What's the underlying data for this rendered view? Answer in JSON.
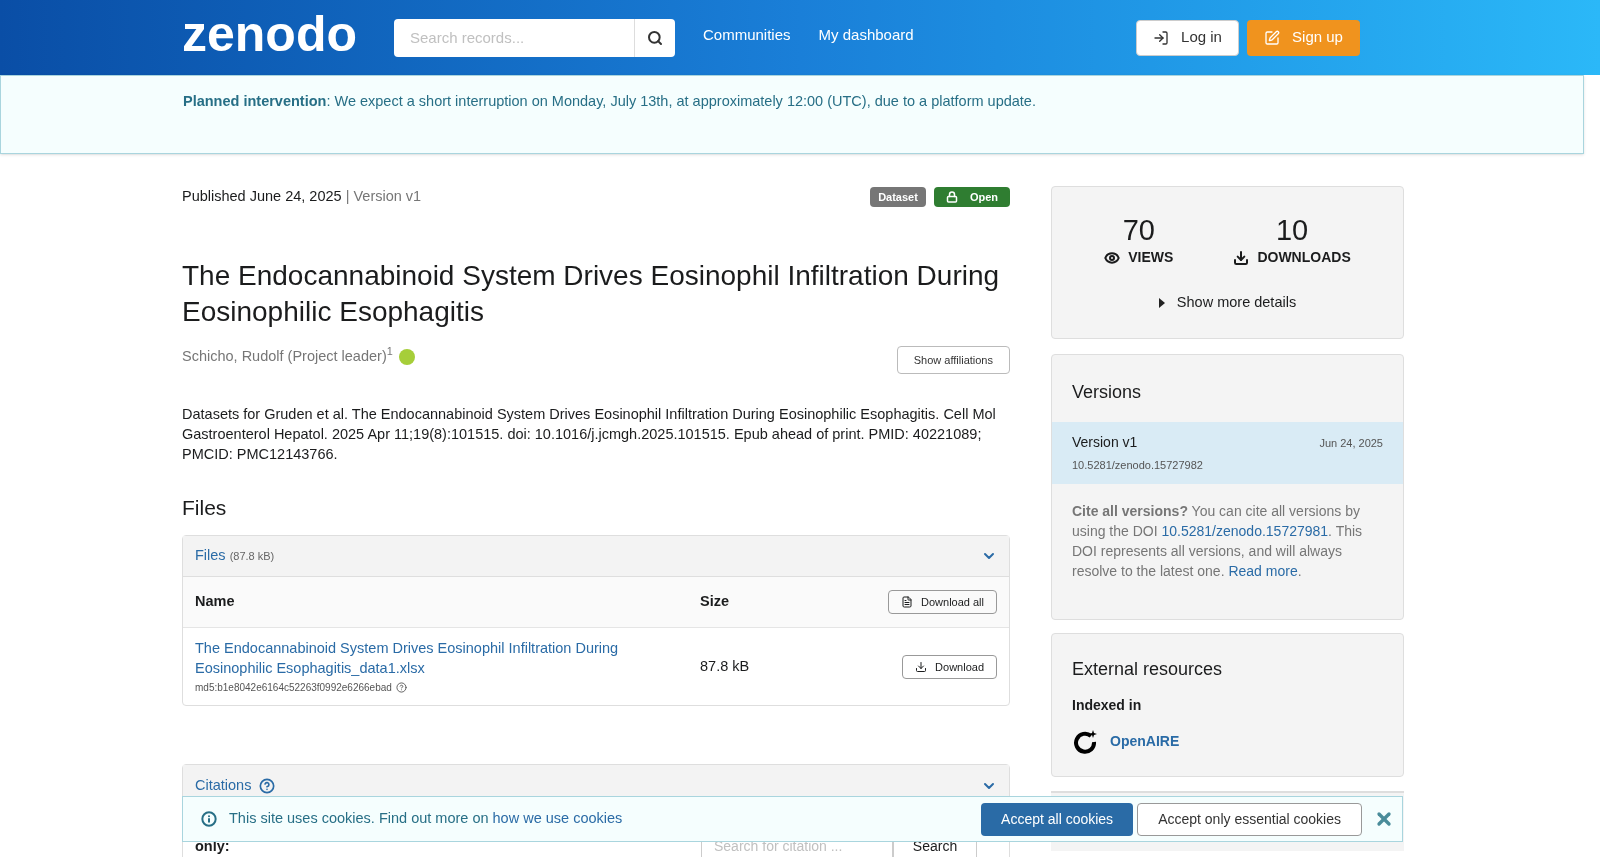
{
  "navbar": {
    "logo": "zenodo",
    "search": {
      "placeholder": "Search records..."
    },
    "links": [
      "Communities",
      "My dashboard"
    ],
    "buttons": [
      {
        "label": "Log in",
        "kind": "login"
      },
      {
        "label": "Sign up",
        "kind": "signup"
      }
    ]
  },
  "announcement": {
    "title": "Planned intervention",
    "text": ": We expect a short interruption on Monday, July 13th, at approximately 12:00 (UTC), due to a platform update."
  },
  "record": {
    "published": "Published June 24, 2025",
    "version": "| Version v1",
    "badges": [
      {
        "label": "Dataset",
        "kind": "type"
      },
      {
        "label": "Open",
        "kind": "access"
      }
    ],
    "title": "The Endocannabinoid System Drives Eosinophil Infiltration During Eosinophilic Esophagitis",
    "creators": [
      {
        "name": "Schicho, Rudolf (Project leader)$^{1}$"
      }
    ],
    "affiliations_button": "Show affiliations",
    "description": "Datasets for Gruden et al. The Endocannabinoid System Drives Eosinophil Infiltration During Eosinophilic Esophagitis. Cell Mol Gastroenterol Hepatol. 2025 Apr 11;19(8):101515. doi: 10.1016/j.jcmgh.2025.101515. Epub ahead of print. PMID: 40221089; PMCID: PMC12143766."
  },
  "files": {
    "heading": "Files",
    "panel_title": "Files",
    "panel_size": "(87.8 kB)",
    "columns": [
      "Name",
      "Size"
    ],
    "download_all": "Download all",
    "rows": [
      {
        "name": "The Endocannabinoid System Drives Eosinophil Infiltration During Eosinophilic Esophagitis_data1.xlsx",
        "md5": "md5:b1e8042e6164c52263f0992e6266ebad",
        "size": "87.8 kB",
        "button": "Download"
      }
    ]
  },
  "citations": {
    "title": "Citations",
    "filter_label": "only:",
    "search": {
      "placeholder": "Search for citation ..."
    },
    "search_button": "Search"
  },
  "stats": {
    "items": [
      {
        "value": "70",
        "label": "VIEWS",
        "kind": "views"
      },
      {
        "value": "10",
        "label": "DOWNLOADS",
        "kind": "downloads"
      }
    ],
    "show_more": "Show more details"
  },
  "versions": {
    "title": "Versions",
    "items": [
      {
        "label": "Version v1",
        "date": "Jun 24, 2025",
        "doi": "10.5281/zenodo.15727982",
        "selected": true
      }
    ],
    "note": [
      {
        "text": "Cite all versions?",
        "kind": "bold"
      },
      {
        "text": " You can cite all versions by using the DOI ",
        "kind": "plain"
      },
      {
        "text": "10.5281/zenodo.15727981",
        "kind": "link"
      },
      {
        "text": ". This DOI represents all versions, and will always resolve to the latest one. ",
        "kind": "plain"
      },
      {
        "text": "Read more",
        "kind": "link"
      },
      {
        "text": ".",
        "kind": "plain"
      }
    ]
  },
  "external": {
    "title": "External resources",
    "indexed_label": "Indexed in",
    "items": [
      {
        "name": "OpenAIRE"
      }
    ]
  },
  "cookies": {
    "text": "This site uses cookies. Find out more on ",
    "link": "how we use cookies",
    "buttons": [
      {
        "label": "Accept all cookies",
        "kind": "primary"
      },
      {
        "label": "Accept only essential cookies",
        "kind": "secondary"
      }
    ]
  }
}
